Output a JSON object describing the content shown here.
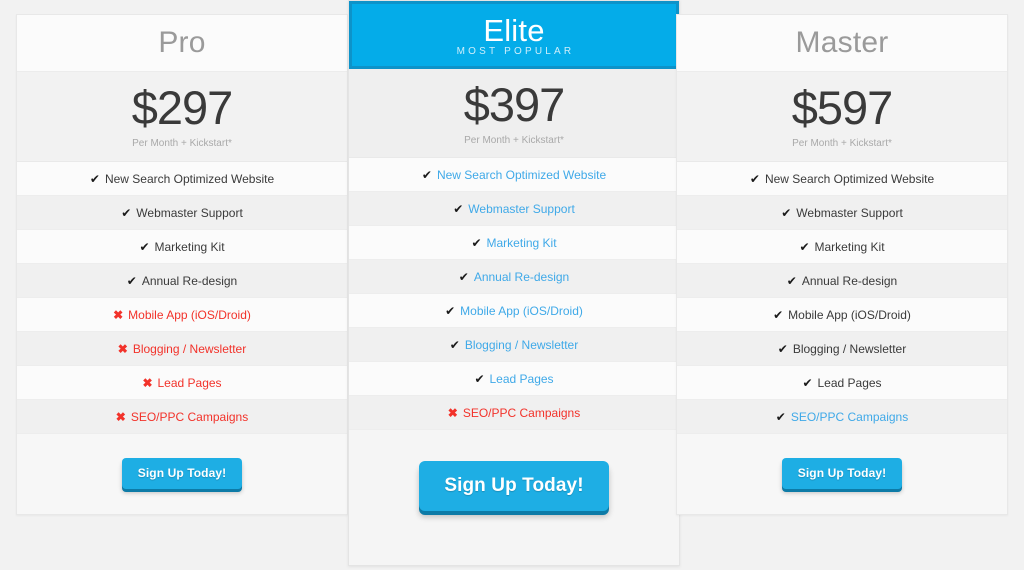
{
  "table": {
    "price_note": "Per Month + Kickstart*",
    "cta_label": "Sign Up Today!",
    "check_icon": "check-icon",
    "cross_icon": "cross-icon",
    "accent_color": "#04ace9",
    "link_color": "#3fa9e8",
    "negative_color": "#f2322a",
    "button_color": "#1eaee4"
  },
  "plans": [
    {
      "name": "Pro",
      "badge": "",
      "price": "$297",
      "price_note": "Per Month + Kickstart*",
      "featured": false,
      "cta_label": "Sign Up Today!",
      "features": [
        {
          "label": "New Search Optimized Website",
          "mark": "check",
          "style": "default"
        },
        {
          "label": "Webmaster Support",
          "mark": "check",
          "style": "default"
        },
        {
          "label": "Marketing Kit",
          "mark": "check",
          "style": "default"
        },
        {
          "label": "Annual Re-design",
          "mark": "check",
          "style": "default"
        },
        {
          "label": "Mobile App (iOS/Droid)",
          "mark": "cross",
          "style": "muted"
        },
        {
          "label": "Blogging / Newsletter",
          "mark": "cross",
          "style": "muted"
        },
        {
          "label": "Lead Pages",
          "mark": "cross",
          "style": "muted"
        },
        {
          "label": "SEO/PPC Campaigns",
          "mark": "cross",
          "style": "muted"
        }
      ]
    },
    {
      "name": "Elite",
      "badge": "MOST POPULAR",
      "price": "$397",
      "price_note": "Per Month + Kickstart*",
      "featured": true,
      "cta_label": "Sign Up Today!",
      "features": [
        {
          "label": "New Search Optimized Website",
          "mark": "check",
          "style": "highlight"
        },
        {
          "label": "Webmaster Support",
          "mark": "check",
          "style": "highlight"
        },
        {
          "label": "Marketing Kit",
          "mark": "check",
          "style": "highlight"
        },
        {
          "label": "Annual Re-design",
          "mark": "check",
          "style": "highlight"
        },
        {
          "label": "Mobile App (iOS/Droid)",
          "mark": "check",
          "style": "highlight"
        },
        {
          "label": "Blogging / Newsletter",
          "mark": "check",
          "style": "highlight"
        },
        {
          "label": "Lead Pages",
          "mark": "check",
          "style": "highlight"
        },
        {
          "label": "SEO/PPC Campaigns",
          "mark": "cross",
          "style": "muted"
        }
      ]
    },
    {
      "name": "Master",
      "badge": "",
      "price": "$597",
      "price_note": "Per Month + Kickstart*",
      "featured": false,
      "cta_label": "Sign Up Today!",
      "features": [
        {
          "label": "New Search Optimized Website",
          "mark": "check",
          "style": "default"
        },
        {
          "label": "Webmaster Support",
          "mark": "check",
          "style": "default"
        },
        {
          "label": "Marketing Kit",
          "mark": "check",
          "style": "default"
        },
        {
          "label": "Annual Re-design",
          "mark": "check",
          "style": "default"
        },
        {
          "label": "Mobile App (iOS/Droid)",
          "mark": "check",
          "style": "default"
        },
        {
          "label": "Blogging / Newsletter",
          "mark": "check",
          "style": "default"
        },
        {
          "label": "Lead Pages",
          "mark": "check",
          "style": "default"
        },
        {
          "label": "SEO/PPC Campaigns",
          "mark": "check",
          "style": "highlight"
        }
      ]
    }
  ]
}
